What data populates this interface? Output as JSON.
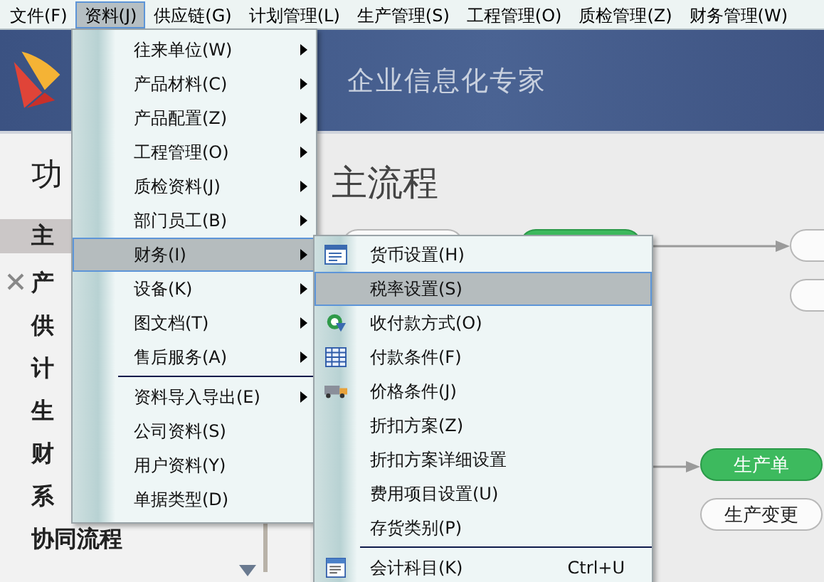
{
  "menubar": {
    "items": [
      {
        "label": "文件(F)",
        "selected": false
      },
      {
        "label": "资料(J)",
        "selected": true
      },
      {
        "label": "供应链(G)",
        "selected": false
      },
      {
        "label": "计划管理(L)",
        "selected": false
      },
      {
        "label": "生产管理(S)",
        "selected": false
      },
      {
        "label": "工程管理(O)",
        "selected": false
      },
      {
        "label": "质检管理(Z)",
        "selected": false
      },
      {
        "label": "财务管理(W)",
        "selected": false
      }
    ]
  },
  "banner": {
    "title": "企业信息化专家"
  },
  "sidebar": {
    "title": "功",
    "items": [
      {
        "label": "主",
        "selected": true
      },
      {
        "label": "产",
        "selected": false
      },
      {
        "label": "供",
        "selected": false
      },
      {
        "label": "计",
        "selected": false
      },
      {
        "label": "生",
        "selected": false
      },
      {
        "label": "财",
        "selected": false
      },
      {
        "label": "系",
        "selected": false
      },
      {
        "label": "协同流程",
        "selected": false
      }
    ]
  },
  "main": {
    "title": "主流程",
    "nodes": [
      {
        "label": "生产单",
        "kind": "green"
      },
      {
        "label": "生产变更",
        "kind": "white"
      }
    ]
  },
  "menu": {
    "items": [
      {
        "kind": "item",
        "label": "往来单位(W)",
        "submenu": true,
        "selected": false
      },
      {
        "kind": "item",
        "label": "产品材料(C)",
        "submenu": true,
        "selected": false
      },
      {
        "kind": "item",
        "label": "产品配置(Z)",
        "submenu": true,
        "selected": false
      },
      {
        "kind": "item",
        "label": "工程管理(O)",
        "submenu": true,
        "selected": false
      },
      {
        "kind": "item",
        "label": "质检资料(J)",
        "submenu": true,
        "selected": false
      },
      {
        "kind": "item",
        "label": "部门员工(B)",
        "submenu": true,
        "selected": false
      },
      {
        "kind": "item",
        "label": "财务(I)",
        "submenu": true,
        "selected": true
      },
      {
        "kind": "item",
        "label": "设备(K)",
        "submenu": true,
        "selected": false
      },
      {
        "kind": "item",
        "label": "图文档(T)",
        "submenu": true,
        "selected": false
      },
      {
        "kind": "item",
        "label": "售后服务(A)",
        "submenu": true,
        "selected": false
      },
      {
        "kind": "separator"
      },
      {
        "kind": "item",
        "label": "资料导入导出(E)",
        "submenu": true,
        "selected": false
      },
      {
        "kind": "item",
        "label": "公司资料(S)",
        "submenu": false,
        "selected": false
      },
      {
        "kind": "item",
        "label": "用户资料(Y)",
        "submenu": false,
        "selected": false
      },
      {
        "kind": "item",
        "label": "单据类型(D)",
        "submenu": false,
        "selected": false
      }
    ]
  },
  "submenu": {
    "items": [
      {
        "kind": "document",
        "label": "货币设置(H)",
        "selected": false
      },
      {
        "kind": "plain",
        "label": "税率设置(S)",
        "selected": true
      },
      {
        "kind": "refresh",
        "label": "收付款方式(O)",
        "selected": false
      },
      {
        "kind": "table",
        "label": "付款条件(F)",
        "selected": false
      },
      {
        "kind": "truck",
        "label": "价格条件(J)",
        "selected": false
      },
      {
        "kind": "plain",
        "label": "折扣方案(Z)",
        "selected": false
      },
      {
        "kind": "plain",
        "label": "折扣方案详细设置",
        "selected": false
      },
      {
        "kind": "plain",
        "label": "费用项目设置(U)",
        "selected": false
      },
      {
        "kind": "plain",
        "label": "存货类别(P)",
        "selected": false
      },
      {
        "kind": "separator"
      },
      {
        "kind": "ledger",
        "label": "会计科目(K)",
        "shortcut": "Ctrl+U",
        "selected": false
      }
    ]
  }
}
